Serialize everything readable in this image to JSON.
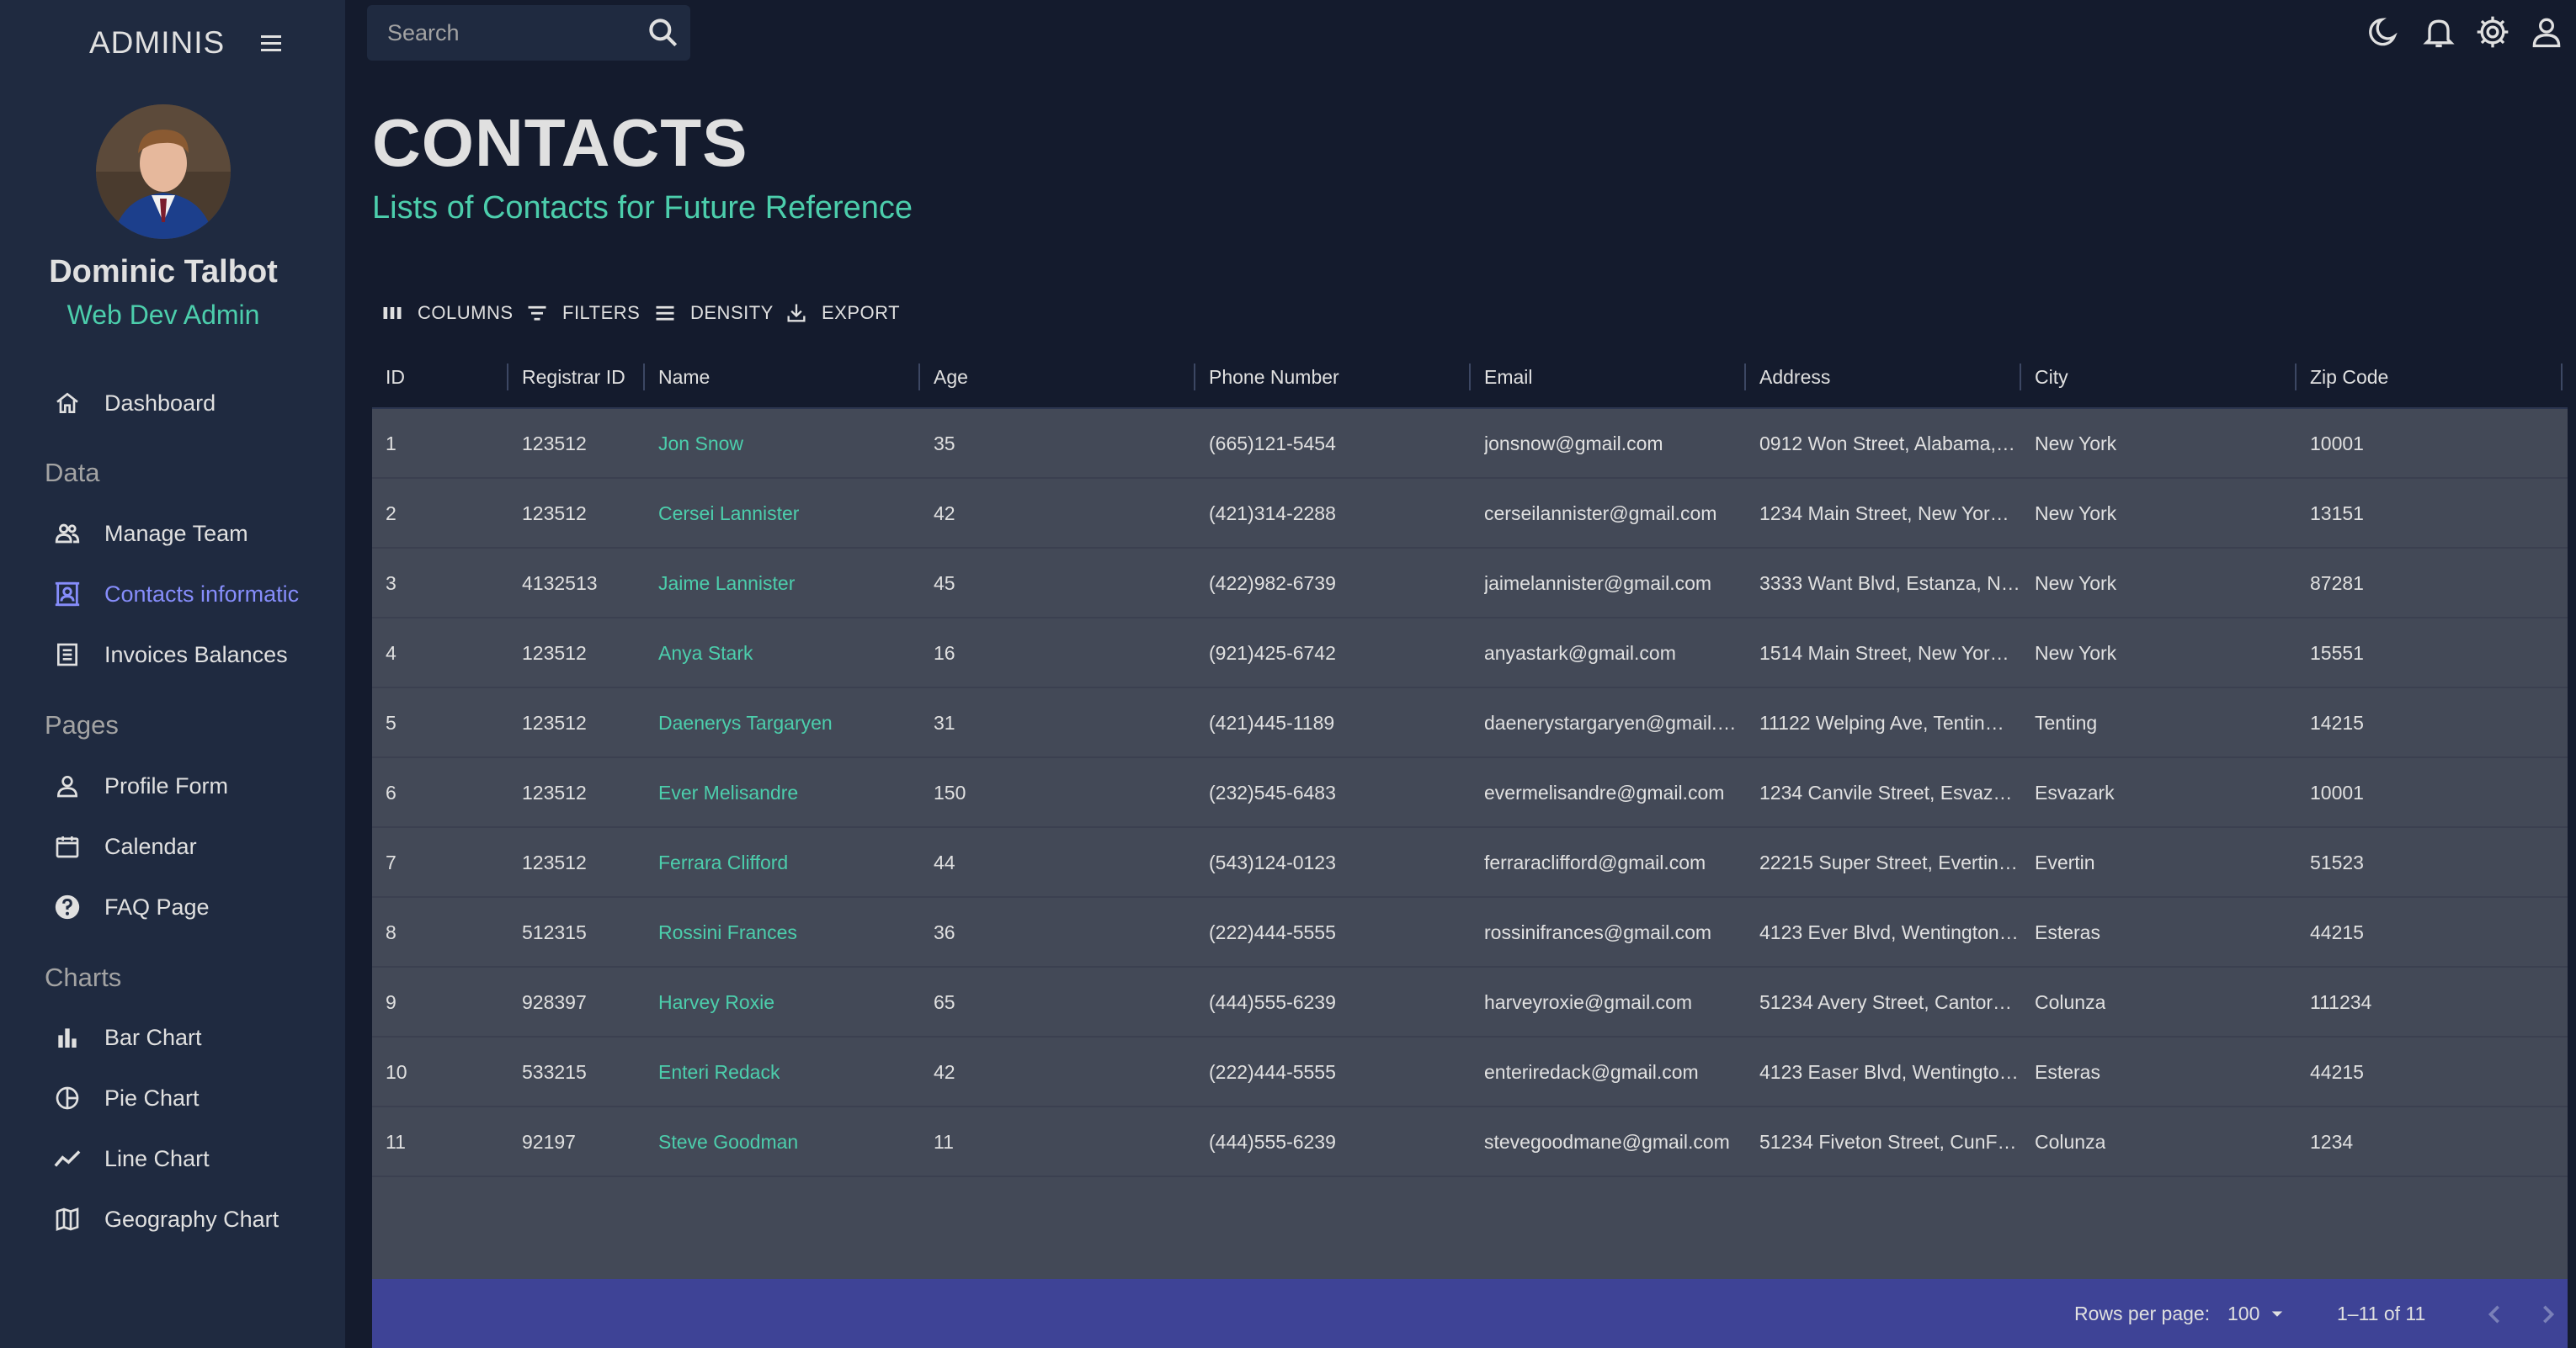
{
  "sidebar": {
    "brand": "ADMINIS",
    "user": {
      "name": "Dominic Talbot",
      "role": "Web Dev Admin"
    },
    "items": [
      {
        "label": "Dashboard",
        "icon": "home-icon"
      },
      {
        "label": "Manage Team",
        "icon": "people-icon"
      },
      {
        "label": "Contacts informatic",
        "icon": "contacts-icon",
        "active": true
      },
      {
        "label": "Invoices Balances",
        "icon": "receipt-icon"
      },
      {
        "label": "Profile Form",
        "icon": "person-icon"
      },
      {
        "label": "Calendar",
        "icon": "calendar-icon"
      },
      {
        "label": "FAQ Page",
        "icon": "help-icon"
      },
      {
        "label": "Bar Chart",
        "icon": "bar-chart-icon"
      },
      {
        "label": "Pie Chart",
        "icon": "pie-chart-icon"
      },
      {
        "label": "Line Chart",
        "icon": "line-chart-icon"
      },
      {
        "label": "Geography Chart",
        "icon": "map-icon"
      }
    ],
    "sections": {
      "data": "Data",
      "pages": "Pages",
      "charts": "Charts"
    }
  },
  "topbar": {
    "search_placeholder": "Search",
    "icons": [
      "dark-mode-icon",
      "notifications-icon",
      "settings-icon",
      "person-icon"
    ]
  },
  "header": {
    "title": "CONTACTS",
    "subtitle": "Lists of Contacts for Future Reference"
  },
  "toolbar": {
    "columns": "COLUMNS",
    "filters": "FILTERS",
    "density": "DENSITY",
    "export": "EXPORT"
  },
  "grid": {
    "columns": [
      "ID",
      "Registrar ID",
      "Name",
      "Age",
      "Phone Number",
      "Email",
      "Address",
      "City",
      "Zip Code"
    ],
    "rows": [
      [
        "1",
        "123512",
        "Jon Snow",
        "35",
        "(665)121-5454",
        "jonsnow@gmail.com",
        "0912 Won Street, Alabama,…",
        "New York",
        "10001"
      ],
      [
        "2",
        "123512",
        "Cersei Lannister",
        "42",
        "(421)314-2288",
        "cerseilannister@gmail.com",
        "1234 Main Street, New Yor…",
        "New York",
        "13151"
      ],
      [
        "3",
        "4132513",
        "Jaime Lannister",
        "45",
        "(422)982-6739",
        "jaimelannister@gmail.com",
        "3333 Want Blvd, Estanza, N…",
        "New York",
        "87281"
      ],
      [
        "4",
        "123512",
        "Anya Stark",
        "16",
        "(921)425-6742",
        "anyastark@gmail.com",
        "1514 Main Street, New Yor…",
        "New York",
        "15551"
      ],
      [
        "5",
        "123512",
        "Daenerys Targaryen",
        "31",
        "(421)445-1189",
        "daenerystargaryen@gmail.…",
        "11122 Welping Ave, Tentin…",
        "Tenting",
        "14215"
      ],
      [
        "6",
        "123512",
        "Ever Melisandre",
        "150",
        "(232)545-6483",
        "evermelisandre@gmail.com",
        "1234 Canvile Street, Esvaz…",
        "Esvazark",
        "10001"
      ],
      [
        "7",
        "123512",
        "Ferrara Clifford",
        "44",
        "(543)124-0123",
        "ferraraclifford@gmail.com",
        "22215 Super Street, Evertin…",
        "Evertin",
        "51523"
      ],
      [
        "8",
        "512315",
        "Rossini Frances",
        "36",
        "(222)444-5555",
        "rossinifrances@gmail.com",
        "4123 Ever Blvd, Wentington…",
        "Esteras",
        "44215"
      ],
      [
        "9",
        "928397",
        "Harvey Roxie",
        "65",
        "(444)555-6239",
        "harveyroxie@gmail.com",
        "51234 Avery Street, Cantor…",
        "Colunza",
        "111234"
      ],
      [
        "10",
        "533215",
        "Enteri Redack",
        "42",
        "(222)444-5555",
        "enteriredack@gmail.com",
        "4123 Easer Blvd, Wentingto…",
        "Esteras",
        "44215"
      ],
      [
        "11",
        "92197",
        "Steve Goodman",
        "11",
        "(444)555-6239",
        "stevegoodmane@gmail.com",
        "51234 Fiveton Street, CunF…",
        "Colunza",
        "1234"
      ]
    ]
  },
  "footer": {
    "rows_per_page_label": "Rows per page:",
    "rows_per_page": "100",
    "range": "1–11 of 11"
  },
  "colors": {
    "background": "#141b2d",
    "sidebar": "#1f2a40",
    "accent_green": "#4cceac",
    "accent_purple": "#868dfb",
    "grid_body": "#434957",
    "footer": "#3e4396"
  }
}
